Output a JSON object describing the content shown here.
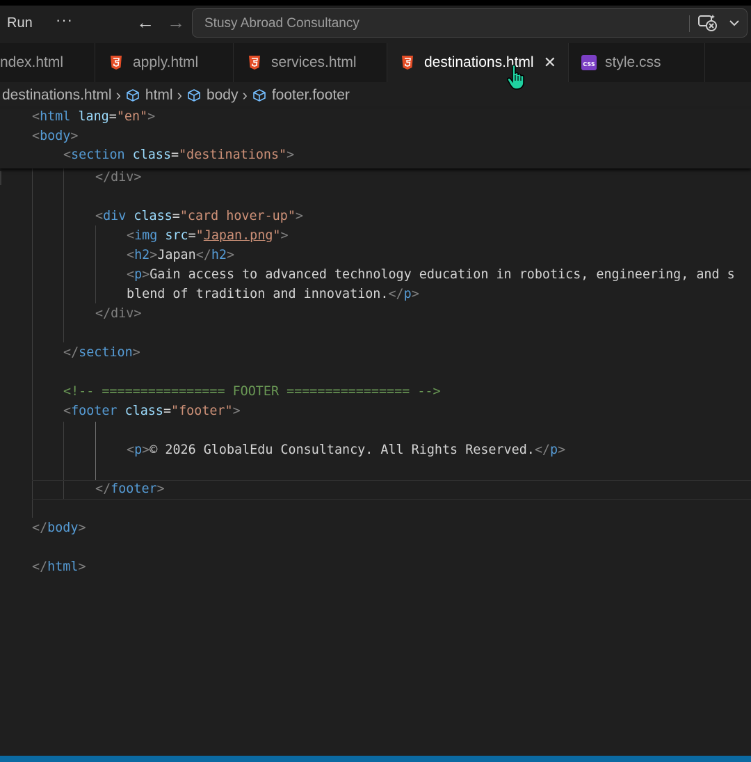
{
  "menu": {
    "run_label": "Run",
    "more_label": "···"
  },
  "nav": {
    "back_icon": "arrow-left-icon",
    "forward_icon": "arrow-right-icon"
  },
  "search": {
    "text": "Stusy Abroad Consultancy"
  },
  "tabs": [
    {
      "label": "ndex.html",
      "icon": "html5-icon",
      "active": false
    },
    {
      "label": "apply.html",
      "icon": "html5-icon",
      "active": false
    },
    {
      "label": "services.html",
      "icon": "html5-icon",
      "active": false
    },
    {
      "label": "destinations.html",
      "icon": "html5-icon",
      "active": true,
      "close": "✕"
    },
    {
      "label": "style.css",
      "icon": "css-icon",
      "active": false
    }
  ],
  "breadcrumb": [
    "destinations.html",
    "html",
    "body",
    "footer.footer"
  ],
  "code": {
    "sticky": [
      {
        "open": "<",
        "tag": "html",
        "attr": " lang",
        "eq": "=",
        "val": "\"en\"",
        "close": ">"
      },
      {
        "open": "<",
        "tag": "body",
        "close": ">"
      },
      {
        "open": "<",
        "tag": "section",
        "attr": " class",
        "eq": "=",
        "val": "\"destinations\"",
        "close": ">"
      }
    ],
    "div_close_1": "</div>",
    "card_open": {
      "open": "<",
      "tag": "div",
      "attr": " class",
      "eq": "=",
      "val": "\"card hover-up\"",
      "close": ">"
    },
    "img": {
      "open": "<",
      "tag": "img",
      "attr": " src",
      "eq": "=",
      "q1": "\"",
      "val": "Japan.png",
      "q2": "\"",
      "close": ">"
    },
    "h2": {
      "open": "<",
      "tag": "h2",
      "close": ">",
      "text": "Japan",
      "end_open": "</",
      "end_close": ">"
    },
    "p_line1": {
      "open": "<",
      "tag": "p",
      "close": ">",
      "text": "Gain access to advanced technology education in robotics, engineering, and s"
    },
    "p_line2": {
      "text": "blend of tradition and innovation.",
      "end_open": "</",
      "tag": "p",
      "end_close": ">"
    },
    "div_close_2": "</div>",
    "section_close": {
      "open": "</",
      "tag": "section",
      "close": ">"
    },
    "comment": "<!-- ================ FOOTER ================ -->",
    "footer_open": {
      "open": "<",
      "tag": "footer",
      "attr": " class",
      "eq": "=",
      "val": "\"footer\"",
      "close": ">"
    },
    "footer_p": {
      "open": "<",
      "tag": "p",
      "close": ">",
      "text": "© 2026 GlobalEdu Consultancy. All Rights Reserved.",
      "end_open": "</",
      "end_close": ">"
    },
    "footer_close": {
      "open": "</",
      "tag": "footer",
      "close": ">"
    },
    "body_close": {
      "open": "</",
      "tag": "body",
      "close": ">"
    },
    "html_close": {
      "open": "</",
      "tag": "html",
      "close": ">"
    }
  },
  "colors": {
    "tag": "#569cd6",
    "attr": "#9cdcfe",
    "string": "#ce9178",
    "comment": "#6a9955",
    "accent": "#0b6aa2"
  }
}
